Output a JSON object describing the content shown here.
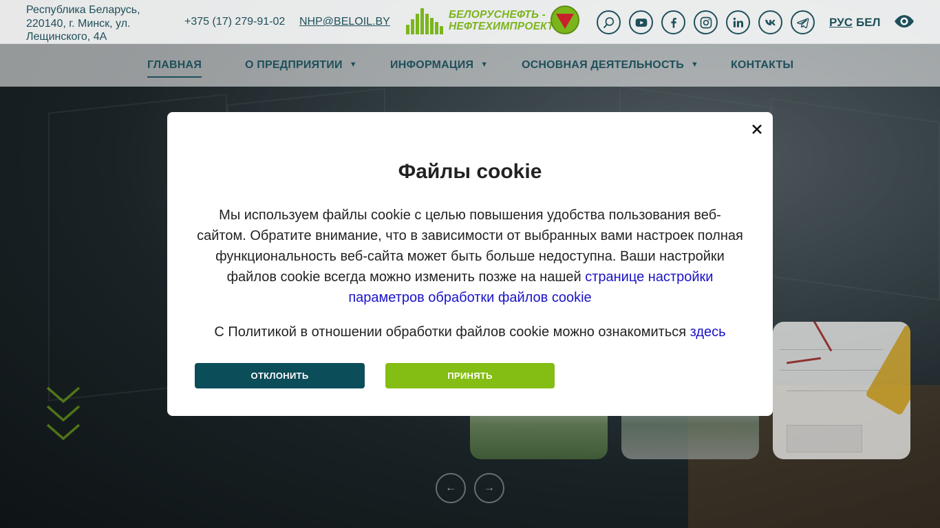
{
  "header": {
    "address": "Республика Беларусь, 220140, г. Минск, ул. Лещинского, 4А",
    "phone": "+375 (17) 279-91-02",
    "email": "NHP@BELOIL.BY",
    "logo_line1": "БЕЛОРУСНЕФТЬ -",
    "logo_line2": "НЕФТЕХИМПРОЕКТ",
    "socials": [
      "search-icon",
      "youtube-icon",
      "facebook-icon",
      "instagram-icon",
      "linkedin-icon",
      "vk-icon",
      "telegram-icon"
    ],
    "lang_ru": "РУС",
    "lang_be": "БЕЛ"
  },
  "nav": {
    "items": [
      {
        "label": "ГЛАВНАЯ",
        "dropdown": false,
        "active": true
      },
      {
        "label": "О ПРЕДПРИЯТИИ",
        "dropdown": true,
        "active": false
      },
      {
        "label": "ИНФОРМАЦИЯ",
        "dropdown": true,
        "active": false
      },
      {
        "label": "ОСНОВНАЯ ДЕЯТЕЛЬНОСТЬ",
        "dropdown": true,
        "active": false
      },
      {
        "label": "КОНТАКТЫ",
        "dropdown": false,
        "active": false
      }
    ],
    "caret": "▼"
  },
  "slider": {
    "prev": "←",
    "next": "→"
  },
  "cookie_modal": {
    "title": "Файлы cookie",
    "body_text": "Мы используем файлы cookie с целью повышения удобства пользования веб-сайтом. Обратите внимание, что в зависимости от выбранных вами настроек полная функциональность веб-сайта может быть больше недоступна. Ваши настройки файлов cookie всегда можно изменить позже на нашей",
    "settings_link": "странице настройки параметров обработки файлов cookie",
    "policy_text": "С Политикой в отношении обработки файлов cookie можно ознакомиться",
    "policy_link": "здесь",
    "decline_label": "ОТКЛОНИТЬ",
    "accept_label": "ПРИНЯТЬ"
  },
  "colors": {
    "brand_dark": "#1e4f5a",
    "brand_green": "#84bd14",
    "decline_bg": "#0c4d5a",
    "link": "#1a12c8"
  }
}
